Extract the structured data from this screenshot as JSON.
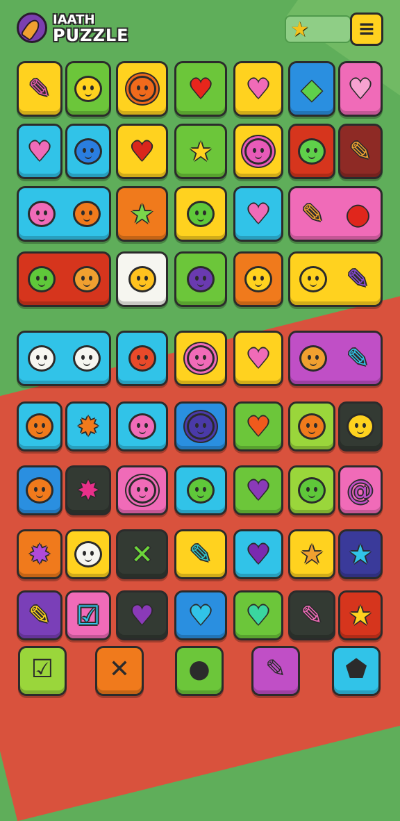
{
  "app": {
    "title_line1": "IAATH",
    "title_line2": "PUZZLE"
  },
  "header": {
    "star_icon": "star-icon",
    "menu_label": "≡"
  },
  "colors": {
    "yellow": "#ffd21f",
    "green": "#6cc63a",
    "lime": "#9ad63b",
    "cyan": "#31c3e8",
    "blue": "#2a8fe0",
    "pink": "#f06bb8",
    "orange": "#f07a1c",
    "red": "#d6351d",
    "maroon": "#8e2a25",
    "purple": "#7a3fb8",
    "dark": "#333a33",
    "white": "#f6f6f0",
    "navy": "#3a3a9a",
    "magenta": "#c04fc6"
  },
  "board": [
    {
      "row": 0,
      "tiles": [
        {
          "bg": "yellow",
          "icons": [
            {
              "type": "glyph",
              "char": "✎",
              "color": "#e05aa8"
            }
          ]
        },
        {
          "bg": "green",
          "icons": [
            {
              "type": "face",
              "color": "#ffd21f"
            }
          ]
        },
        {
          "bg": "yellow",
          "icons": [
            {
              "type": "face",
              "color": "#f06a1c",
              "spiky": true
            }
          ]
        },
        {
          "bg": "green",
          "icons": [
            {
              "type": "heart",
              "color": "#e8261c"
            }
          ]
        },
        {
          "bg": "yellow",
          "icons": [
            {
              "type": "heart",
              "color": "#f06bb8"
            }
          ]
        },
        {
          "bg": "blue",
          "icons": [
            {
              "type": "glyph",
              "char": "◆",
              "color": "#5fd04a"
            }
          ]
        },
        {
          "bg": "pink",
          "icons": [
            {
              "type": "heart",
              "color": "#f7a2d0"
            }
          ]
        }
      ]
    },
    {
      "row": 1,
      "tiles": [
        {
          "bg": "cyan",
          "icons": [
            {
              "type": "heart",
              "color": "#f06bb8"
            }
          ]
        },
        {
          "bg": "cyan",
          "icons": [
            {
              "type": "face",
              "color": "#2a7ee0"
            }
          ]
        },
        {
          "bg": "yellow",
          "icons": [
            {
              "type": "heart",
              "color": "#d9261c"
            }
          ]
        },
        {
          "bg": "green",
          "icons": [
            {
              "type": "glyph",
              "char": "★",
              "color": "#ffd21f"
            }
          ]
        },
        {
          "bg": "yellow",
          "icons": [
            {
              "type": "face",
              "color": "#e85ab8",
              "spiky": true
            }
          ]
        },
        {
          "bg": "red",
          "icons": [
            {
              "type": "face",
              "color": "#5fd04a"
            }
          ]
        },
        {
          "bg": "maroon",
          "icons": [
            {
              "type": "glyph",
              "char": "✎",
              "color": "#f0a030"
            }
          ]
        }
      ]
    },
    {
      "row": 2,
      "tiles": [
        {
          "bg": "cyan",
          "wide": true,
          "icons": [
            {
              "type": "face",
              "color": "#f06bb8"
            },
            {
              "type": "face",
              "color": "#f07a1c"
            }
          ]
        },
        {
          "bg": "orange",
          "icons": [
            {
              "type": "glyph",
              "char": "★",
              "color": "#7ad64a"
            }
          ]
        },
        {
          "bg": "yellow",
          "icons": [
            {
              "type": "face",
              "color": "#5fc83a"
            }
          ]
        },
        {
          "bg": "cyan",
          "icons": [
            {
              "type": "heart",
              "color": "#f06bb8"
            }
          ]
        },
        {
          "bg": "pink",
          "wide": true,
          "icons": [
            {
              "type": "glyph",
              "char": "✎",
              "color": "#f0a030"
            },
            {
              "type": "glyph",
              "char": "●",
              "color": "#e0261c"
            }
          ]
        }
      ]
    },
    {
      "row": 3,
      "tiles": [
        {
          "bg": "red",
          "wide": true,
          "icons": [
            {
              "type": "face",
              "color": "#5fc83a"
            },
            {
              "type": "face",
              "color": "#f0a030"
            }
          ]
        },
        {
          "bg": "white",
          "icons": [
            {
              "type": "face",
              "color": "#ffc21f"
            }
          ]
        },
        {
          "bg": "green",
          "icons": [
            {
              "type": "face",
              "color": "#6a3ab0"
            }
          ]
        },
        {
          "bg": "orange",
          "icons": [
            {
              "type": "face",
              "color": "#ffd21f"
            }
          ]
        },
        {
          "bg": "yellow",
          "wide": true,
          "icons": [
            {
              "type": "face",
              "color": "#ffd21f"
            },
            {
              "type": "glyph",
              "char": "✎",
              "color": "#8a4ad8"
            }
          ]
        }
      ]
    },
    {
      "row": 4,
      "tiles": [
        {
          "bg": "cyan",
          "wide": true,
          "icons": [
            {
              "type": "face",
              "color": "#f6f6f0"
            },
            {
              "type": "face",
              "color": "#f6f6f0"
            }
          ]
        },
        {
          "bg": "cyan",
          "icons": [
            {
              "type": "face",
              "color": "#e84a2a"
            }
          ]
        },
        {
          "bg": "yellow",
          "icons": [
            {
              "type": "face",
              "color": "#f06bb8",
              "spiky": true
            }
          ]
        },
        {
          "bg": "yellow",
          "icons": [
            {
              "type": "heart",
              "color": "#f06bb8"
            }
          ]
        },
        {
          "bg": "magenta",
          "wide": true,
          "icons": [
            {
              "type": "face",
              "color": "#f0a030"
            },
            {
              "type": "glyph",
              "char": "✎",
              "color": "#31c3e8"
            }
          ]
        }
      ]
    },
    {
      "row": 5,
      "tiles": [
        {
          "bg": "cyan",
          "icons": [
            {
              "type": "face",
              "color": "#f07a1c"
            }
          ]
        },
        {
          "bg": "cyan",
          "icons": [
            {
              "type": "glyph",
              "char": "✸",
              "color": "#f07a1c"
            }
          ]
        },
        {
          "bg": "cyan",
          "icons": [
            {
              "type": "face",
              "color": "#f06bb8"
            }
          ]
        },
        {
          "bg": "blue",
          "icons": [
            {
              "type": "face",
              "color": "#4a3aa8",
              "spiky": true
            }
          ]
        },
        {
          "bg": "green",
          "icons": [
            {
              "type": "heart",
              "color": "#f05a1c"
            }
          ]
        },
        {
          "bg": "lime",
          "icons": [
            {
              "type": "face",
              "color": "#f07a1c"
            }
          ]
        },
        {
          "bg": "dark",
          "icons": [
            {
              "type": "face",
              "color": "#ffd21f"
            }
          ]
        }
      ]
    },
    {
      "row": 6,
      "tiles": [
        {
          "bg": "blue",
          "icons": [
            {
              "type": "face",
              "color": "#f07a1c"
            }
          ]
        },
        {
          "bg": "dark",
          "icons": [
            {
              "type": "glyph",
              "char": "✸",
              "color": "#e8308a"
            }
          ]
        },
        {
          "bg": "pink",
          "icons": [
            {
              "type": "face",
              "color": "#f06bb8",
              "spiky": true
            }
          ]
        },
        {
          "bg": "cyan",
          "icons": [
            {
              "type": "face",
              "color": "#5fc83a"
            }
          ]
        },
        {
          "bg": "green",
          "icons": [
            {
              "type": "heart",
              "color": "#8a3ab8"
            }
          ]
        },
        {
          "bg": "lime",
          "icons": [
            {
              "type": "face",
              "color": "#5fc83a"
            }
          ]
        },
        {
          "bg": "pink",
          "icons": [
            {
              "type": "glyph",
              "char": "@",
              "color": "#c04fc6"
            }
          ]
        }
      ]
    },
    {
      "row": 7,
      "tiles": [
        {
          "bg": "orange",
          "icons": [
            {
              "type": "glyph",
              "char": "✸",
              "color": "#b04ad8"
            }
          ]
        },
        {
          "bg": "yellow",
          "icons": [
            {
              "type": "face",
              "color": "#f6f6f0"
            }
          ]
        },
        {
          "bg": "dark",
          "icons": [
            {
              "type": "glyph",
              "char": "✕",
              "color": "#6cd63a"
            }
          ]
        },
        {
          "bg": "yellow",
          "icons": [
            {
              "type": "glyph",
              "char": "✎",
              "color": "#31c3c8"
            }
          ]
        },
        {
          "bg": "cyan",
          "icons": [
            {
              "type": "heart",
              "color": "#7a2ab0"
            }
          ]
        },
        {
          "bg": "yellow",
          "icons": [
            {
              "type": "glyph",
              "char": "★",
              "color": "#f0a030"
            }
          ]
        },
        {
          "bg": "navy",
          "icons": [
            {
              "type": "glyph",
              "char": "★",
              "color": "#31c3e8"
            }
          ]
        }
      ]
    },
    {
      "row": 8,
      "tiles": [
        {
          "bg": "purple",
          "icons": [
            {
              "type": "glyph",
              "char": "✎",
              "color": "#ffd21f"
            }
          ]
        },
        {
          "bg": "pink",
          "icons": [
            {
              "type": "glyph",
              "char": "☑",
              "color": "#31c3e8"
            }
          ]
        },
        {
          "bg": "dark",
          "icons": [
            {
              "type": "heart",
              "color": "#8a3ab8"
            }
          ]
        },
        {
          "bg": "blue",
          "icons": [
            {
              "type": "heart",
              "color": "#31c3e8"
            }
          ]
        },
        {
          "bg": "green",
          "icons": [
            {
              "type": "heart",
              "color": "#3ad6a0"
            }
          ]
        },
        {
          "bg": "dark",
          "icons": [
            {
              "type": "glyph",
              "char": "✎",
              "color": "#f06bb8"
            }
          ]
        },
        {
          "bg": "red",
          "icons": [
            {
              "type": "glyph",
              "char": "★",
              "color": "#ffd21f"
            }
          ]
        }
      ]
    }
  ],
  "bottom_bar": [
    {
      "name": "check-button",
      "char": "☑",
      "bg": "lime"
    },
    {
      "name": "cross-button",
      "char": "✕",
      "bg": "orange"
    },
    {
      "name": "bomb-button",
      "char": "●",
      "bg": "green"
    },
    {
      "name": "pencil-button",
      "char": "✎",
      "bg": "magenta"
    },
    {
      "name": "paint-button",
      "char": "⬟",
      "bg": "cyan"
    }
  ]
}
